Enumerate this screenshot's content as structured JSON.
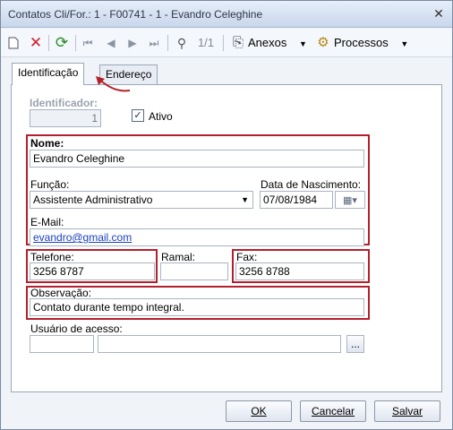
{
  "window": {
    "title": "Contatos Cli/For.: 1 - F00741 - 1 - Evandro Celeghine",
    "close_glyph": "✕"
  },
  "toolbar": {
    "new_icon": "new-document-icon",
    "delete_icon": "delete-icon",
    "refresh_icon": "refresh-icon",
    "record_position": "1/1",
    "anexos_label": "Anexos",
    "processos_label": "Processos"
  },
  "tabs": [
    {
      "label": "Identificação",
      "active": true
    },
    {
      "label": "Endereço",
      "active": false
    }
  ],
  "form": {
    "identificador": {
      "label": "Identificador:",
      "value": "1"
    },
    "ativo": {
      "label": "Ativo",
      "checked": true,
      "mark": "✓"
    },
    "nome": {
      "label": "Nome:",
      "value": "Evandro Celeghine"
    },
    "funcao": {
      "label": "Função:",
      "value": "Assistente Administrativo"
    },
    "data_nascimento": {
      "label": "Data de Nascimento:",
      "value": "07/08/1984"
    },
    "email": {
      "label": "E-Mail:",
      "value": "evandro@gmail.com"
    },
    "telefone": {
      "label": "Telefone:",
      "value": "3256 8787"
    },
    "ramal": {
      "label": "Ramal:",
      "value": ""
    },
    "fax": {
      "label": "Fax:",
      "value": "3256 8788"
    },
    "observacao": {
      "label": "Observação:",
      "value": "Contato durante tempo integral."
    },
    "usuario_acesso": {
      "label": "Usuário de acesso:",
      "code": "",
      "name": "",
      "browse_label": "..."
    }
  },
  "buttons": {
    "ok": "OK",
    "cancel": "Cancelar",
    "save": "Salvar"
  },
  "colors": {
    "highlight": "#b3202c",
    "link": "#1a3fbf",
    "title_bg": "#c9d7ec"
  }
}
